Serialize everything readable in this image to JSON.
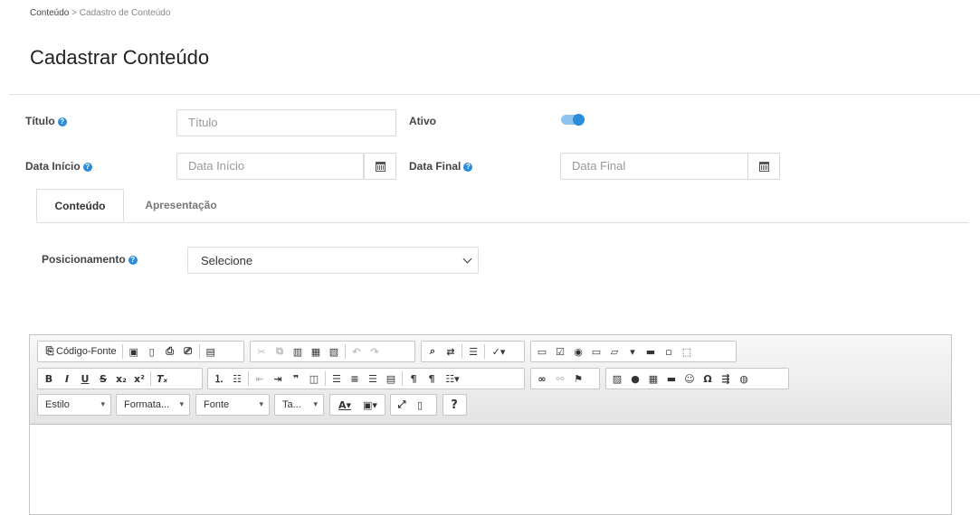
{
  "breadcrumb": {
    "home": "Conteúdo",
    "separator": " > ",
    "current": "Cadastro de Conteúdo"
  },
  "page_title": "Cadastrar Conteúdo",
  "form": {
    "titulo_label": "Título",
    "titulo_placeholder": "Título",
    "ativo_label": "Ativo",
    "ativo_on": true,
    "data_inicio_label": "Data Início",
    "data_inicio_placeholder": "Data Início",
    "data_final_label": "Data Final",
    "data_final_placeholder": "Data Final",
    "help_glyph": "?"
  },
  "tabs": [
    {
      "label": "Conteúdo",
      "active": true
    },
    {
      "label": "Apresentação",
      "active": false
    }
  ],
  "posicionamento": {
    "label": "Posicionamento",
    "value": "Selecione"
  },
  "editor": {
    "source_label": "Código-Fonte",
    "combos": [
      "Estilo",
      "Formata...",
      "Fonte",
      "Ta..."
    ],
    "help_label": "?",
    "colors": {
      "accent": "#2a8cdb",
      "toggle_track": "#8ec3ef"
    }
  }
}
